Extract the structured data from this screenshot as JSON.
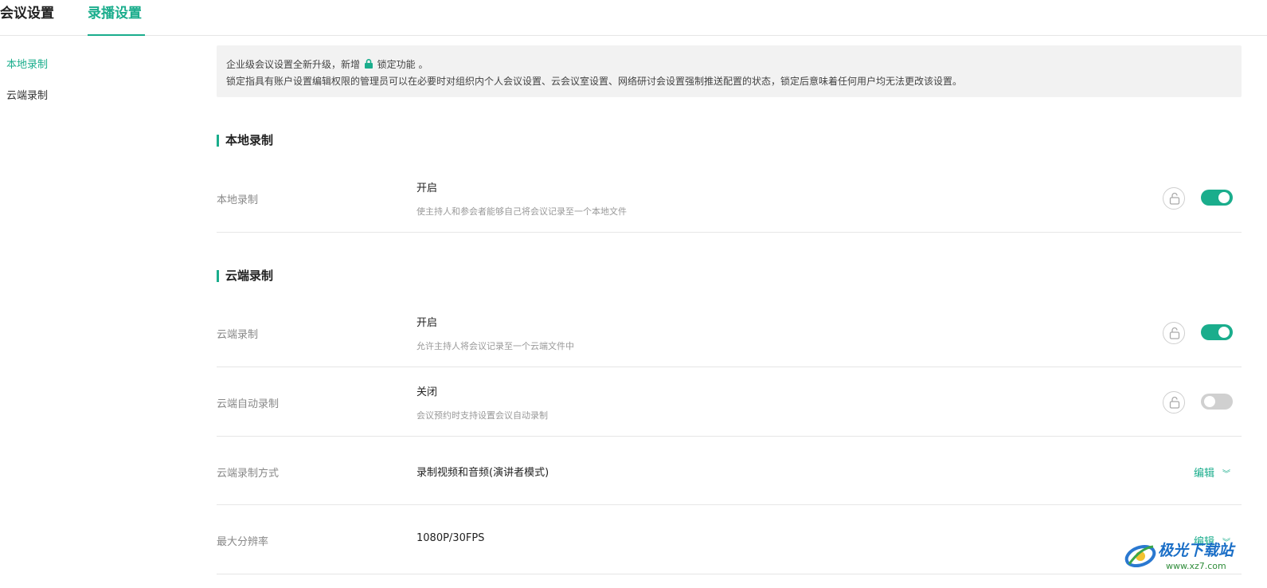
{
  "tabs": [
    {
      "label": "会议设置",
      "active": false
    },
    {
      "label": "录播设置",
      "active": true
    }
  ],
  "sidebar": {
    "items": [
      {
        "label": "本地录制",
        "active": true
      },
      {
        "label": "云端录制",
        "active": false
      }
    ]
  },
  "notice": {
    "line1_before": "企业级会议设置全新升级，新增",
    "line1_after": "锁定功能 。",
    "line2": "锁定指具有账户设置编辑权限的管理员可以在必要时对组织内个人会议设置、云会议室设置、网络研讨会设置强制推送配置的状态，锁定后意味着任何用户均无法更改该设置。"
  },
  "sections": {
    "local": {
      "title": "本地录制",
      "rows": [
        {
          "label": "本地录制",
          "value": "开启",
          "desc": "使主持人和参会者能够自己将会议记录至一个本地文件",
          "enabled": true
        }
      ]
    },
    "cloud": {
      "title": "云端录制",
      "rows": [
        {
          "label": "云端录制",
          "value": "开启",
          "desc": "允许主持人将会议记录至一个云端文件中",
          "enabled": true
        },
        {
          "label": "云端自动录制",
          "value": "关闭",
          "desc": "会议预约时支持设置会议自动录制",
          "enabled": false
        },
        {
          "label": "云端录制方式",
          "value": "录制视频和音频(演讲者模式)",
          "action": "编辑"
        },
        {
          "label": "最大分辨率",
          "value": "1080P/30FPS",
          "action": "编辑"
        }
      ]
    }
  },
  "colors": {
    "accent": "#1aad8c",
    "toggle_off": "#d0d0d0",
    "notice_bg": "#f2f2f2"
  },
  "watermark": {
    "name": "极光下载站",
    "url": "www.xz7.com"
  }
}
